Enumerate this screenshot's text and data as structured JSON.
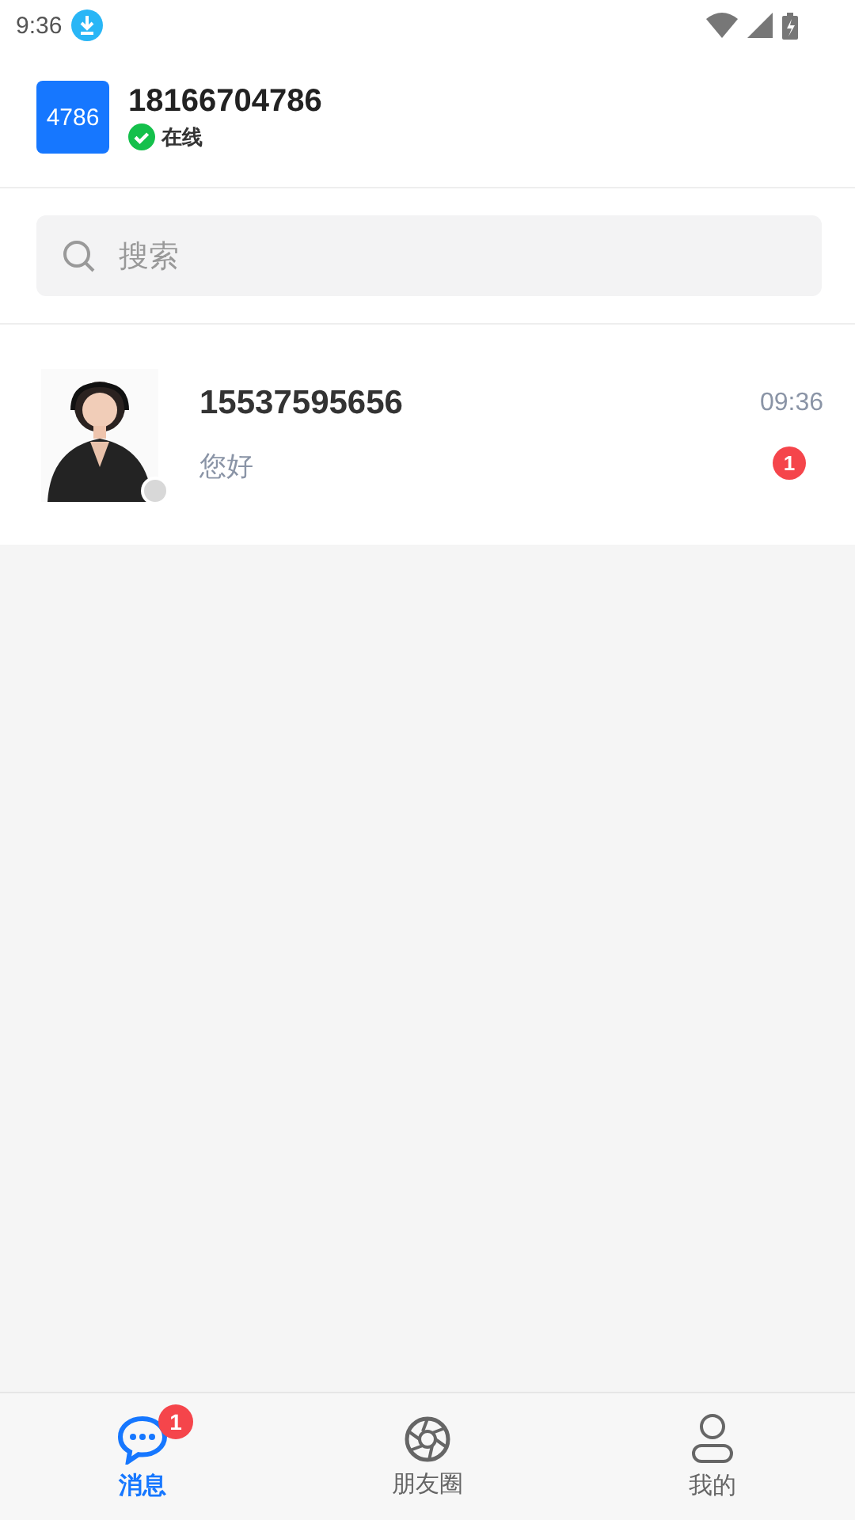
{
  "status_bar": {
    "time": "9:36"
  },
  "profile": {
    "avatar_text": "4786",
    "name": "18166704786",
    "online": true,
    "status": "在线"
  },
  "search": {
    "placeholder": "搜索"
  },
  "conversations": [
    {
      "name": "15537595656",
      "message": "您好",
      "time": "09:36",
      "unread": "1",
      "online": false
    }
  ],
  "tabs": [
    {
      "label": "消息",
      "selected": true,
      "badge": "1",
      "kind": "chat"
    },
    {
      "label": "朋友圈",
      "selected": false,
      "kind": "moments"
    },
    {
      "label": "我的",
      "selected": false,
      "kind": "profile"
    }
  ]
}
